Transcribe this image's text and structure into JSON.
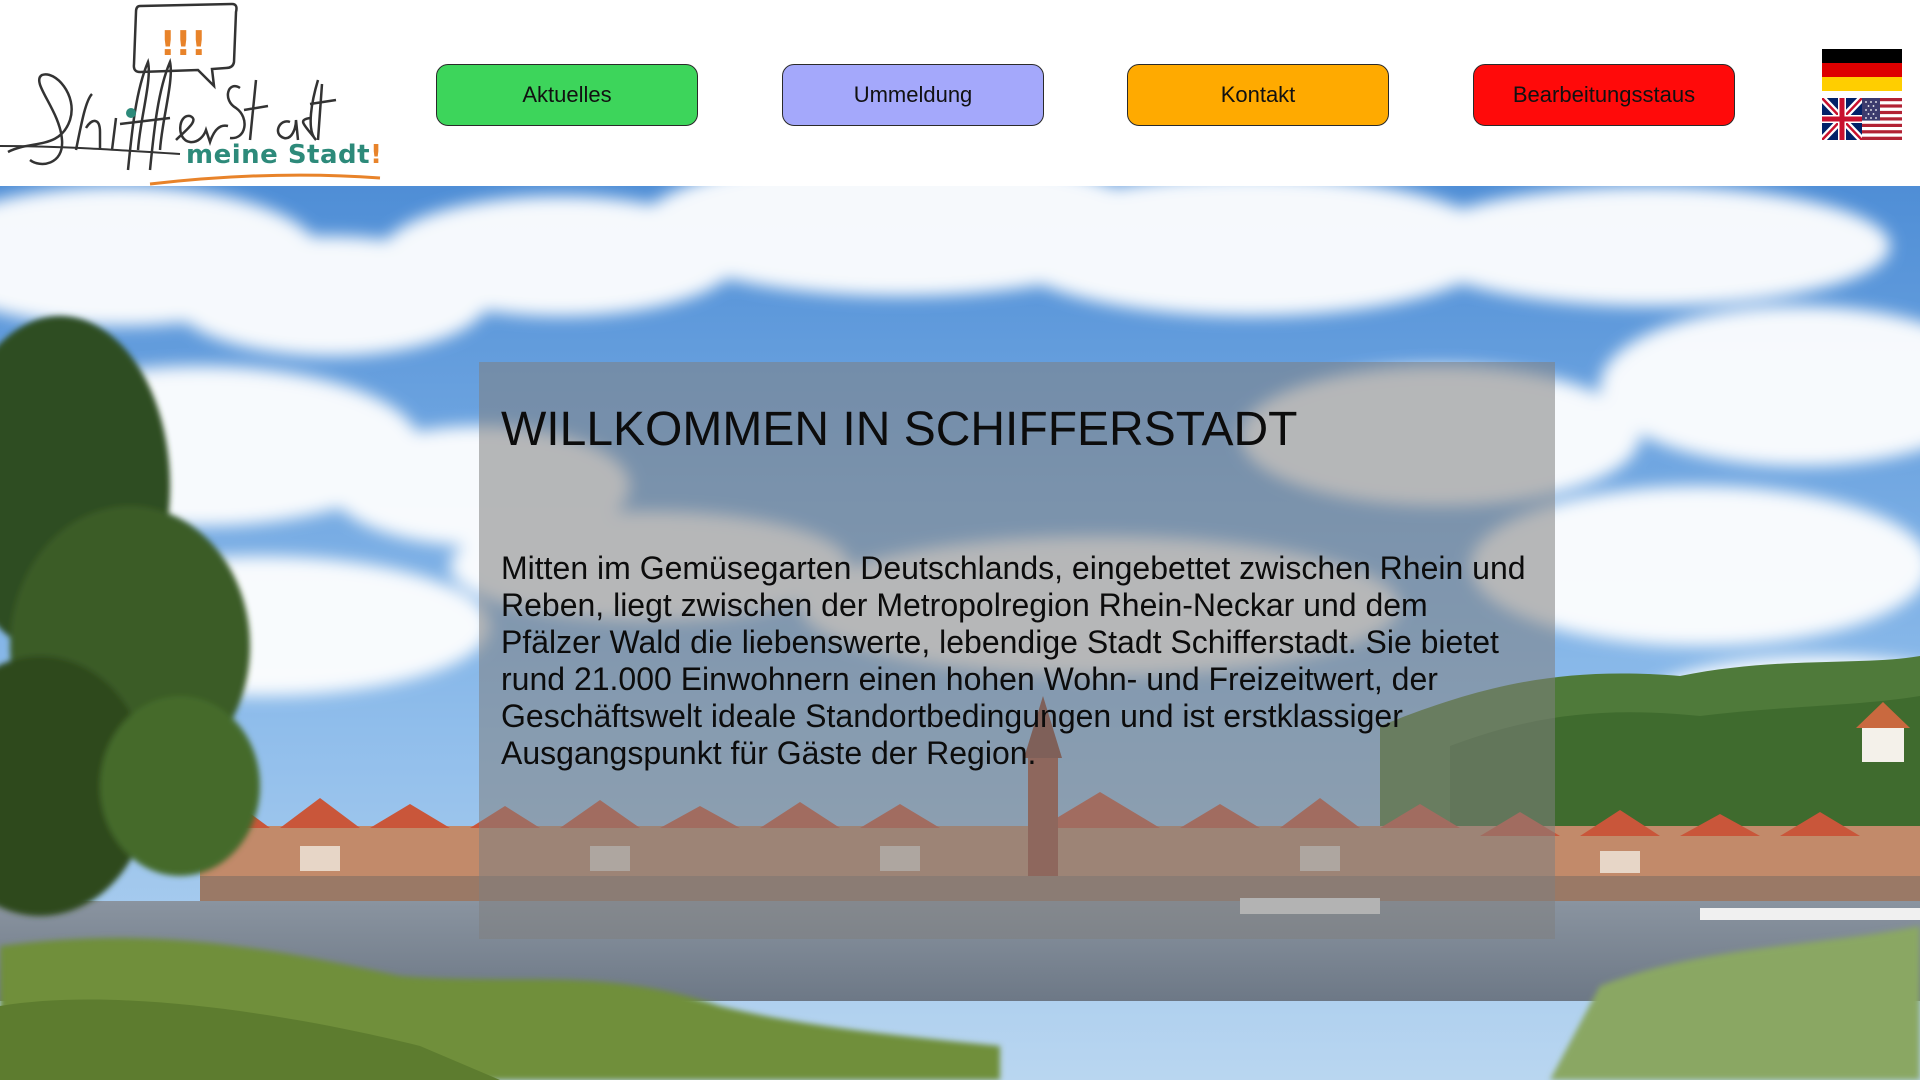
{
  "logo": {
    "exclamations": "!!!",
    "script_name": "Schifferstadt",
    "tagline": "meine Stadt",
    "tagline_excl": "!"
  },
  "nav": {
    "items": [
      {
        "label": "Aktuelles",
        "color": "#3dd55b"
      },
      {
        "label": "Ummeldung",
        "color": "#a4a8fb"
      },
      {
        "label": "Kontakt",
        "color": "#ffaa00"
      },
      {
        "label": "Bearbeitungsstaus",
        "color": "#ff0a0a"
      }
    ]
  },
  "languages": [
    {
      "icon": "german-flag-icon"
    },
    {
      "icon": "uk-us-flag-icon"
    }
  ],
  "welcome": {
    "title": "WILLKOMMEN IN SCHIFFERSTADT",
    "text": "Mitten im Gemüsegarten Deutschlands, eingebettet zwischen Rhein und Reben, liegt zwischen der Metropolregion Rhein-Neckar und dem Pfälzer Wald die liebenswerte, lebendige Stadt Schifferstadt. Sie bietet rund 21.000 Einwohnern einen hohen Wohn- und Freizeitwert, der Geschäftswelt ideale Standortbedingungen und ist erstklassiger Ausgangspunkt für Gäste der Region."
  },
  "colors": {
    "logo_teal": "#2d8a7a",
    "logo_orange": "#e8832a",
    "overlay": "rgba(128,128,128,0.55)"
  }
}
